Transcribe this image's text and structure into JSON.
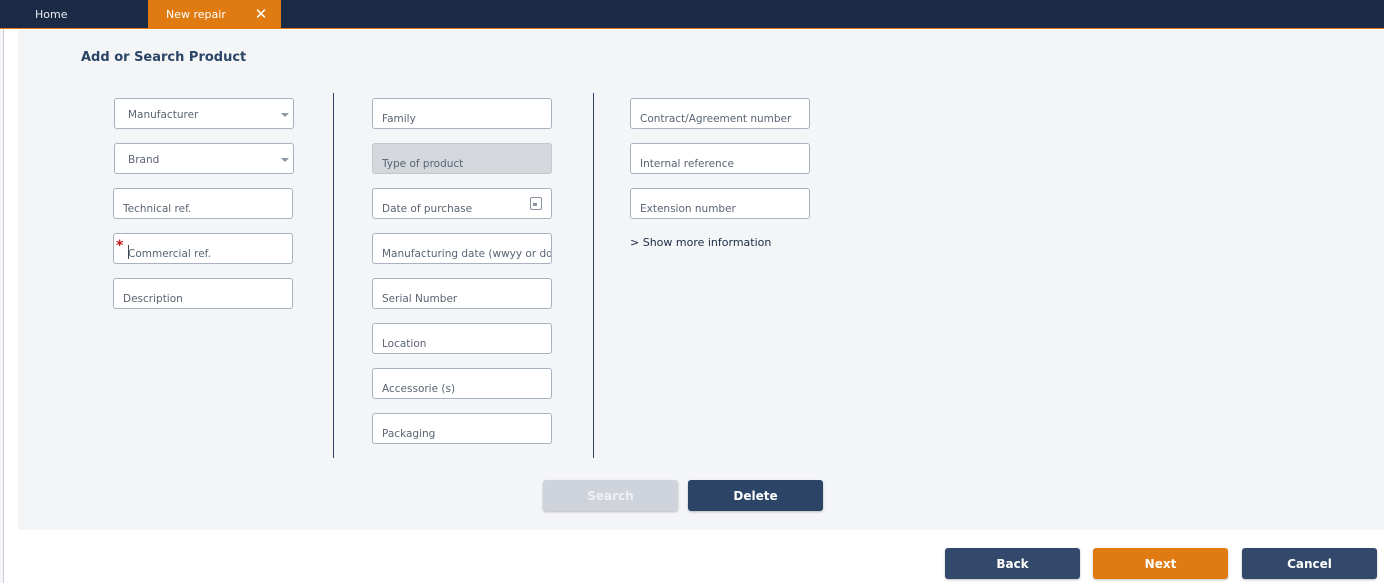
{
  "tabs": {
    "home": "Home",
    "active": "New repair",
    "close_glyph": "✕"
  },
  "panel": {
    "title": "Add or Search Product"
  },
  "fields": {
    "manufacturer": "Manufacturer",
    "brand": "Brand",
    "technical_ref": "Technical ref.",
    "commercial_ref": "Commercial ref.",
    "description": "Description",
    "family": "Family",
    "type_of_product": "Type of product",
    "date_of_purchase": "Date of purchase",
    "manufacturing_date": "Manufacturing date (wwyy or dddyy)",
    "serial_number": "Serial Number",
    "location": "Location",
    "accessories": "Accessorie (s)",
    "packaging": "Packaging",
    "contract_number": "Contract/Agreement number",
    "internal_reference": "Internal reference",
    "extension_number": "Extension number",
    "required_mark": "*"
  },
  "links": {
    "show_more": "> Show more information"
  },
  "buttons": {
    "search": "Search",
    "delete": "Delete",
    "back": "Back",
    "next": "Next",
    "cancel": "Cancel"
  },
  "colors": {
    "navy": "#1c2b45",
    "accent_orange": "#e07b12",
    "button_navy": "#33496b",
    "required_red": "#c0141a"
  }
}
